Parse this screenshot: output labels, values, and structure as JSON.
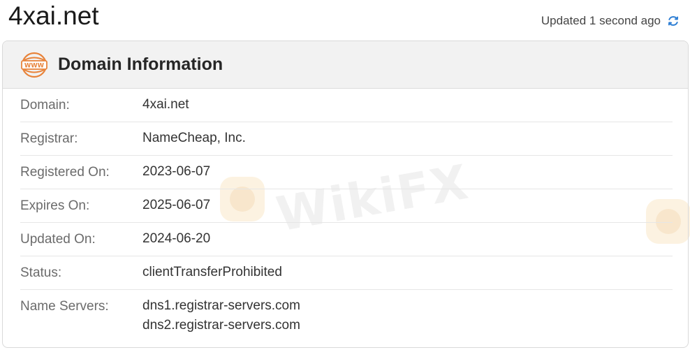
{
  "page": {
    "title": "4xai.net",
    "updated_text": "Updated 1 second ago"
  },
  "card": {
    "title": "Domain Information",
    "header_icon": "www-icon",
    "rows": [
      {
        "label": "Domain:",
        "value": "4xai.net"
      },
      {
        "label": "Registrar:",
        "value": "NameCheap, Inc."
      },
      {
        "label": "Registered On:",
        "value": "2023-06-07"
      },
      {
        "label": "Expires On:",
        "value": "2025-06-07"
      },
      {
        "label": "Updated On:",
        "value": "2024-06-20"
      },
      {
        "label": "Status:",
        "value": "clientTransferProhibited"
      },
      {
        "label": "Name Servers:",
        "values": [
          "dns1.registrar-servers.com",
          "dns2.registrar-servers.com"
        ]
      }
    ]
  },
  "watermark": {
    "text": "WikiFX"
  },
  "colors": {
    "accent": "#e8833a",
    "refresh": "#2f7fd4"
  }
}
